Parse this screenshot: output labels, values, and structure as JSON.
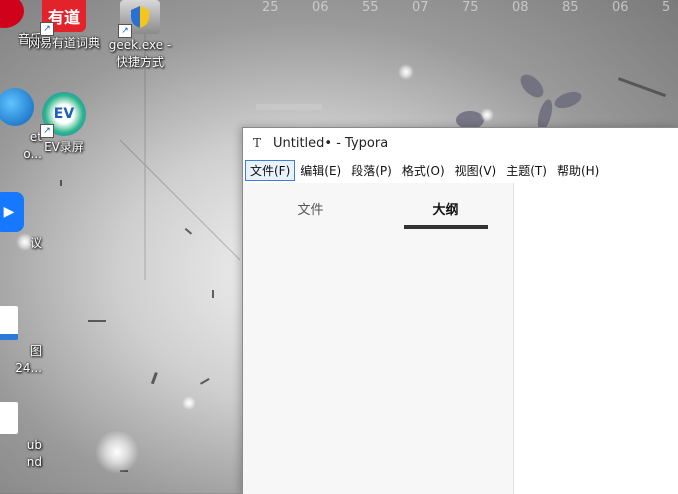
{
  "desktop": {
    "icons": [
      {
        "label": "音乐",
        "icon": "music-app-icon"
      },
      {
        "label": "网易有道词典",
        "icon": "youdao-dict-icon",
        "glyph": "有道"
      },
      {
        "label": "geek.exe - 快捷方式",
        "line1": "geek.exe -",
        "line2": "快捷方式",
        "icon": "geek-exe-icon"
      },
      {
        "label": "et",
        "line1": "et",
        "line2": "o...",
        "icon": "browser-icon"
      },
      {
        "label": "EV录屏",
        "icon": "ev-recorder-icon",
        "glyph": "EV"
      },
      {
        "label": "议",
        "icon": "meeting-app-icon"
      },
      {
        "label": "图",
        "line1": "图",
        "line2": "24...",
        "icon": "image-file-icon"
      },
      {
        "label": "ub",
        "line1": "ub",
        "line2": "nd",
        "icon": "document-file-icon"
      }
    ]
  },
  "window": {
    "title": "Untitled• - Typora",
    "app_icon": "T",
    "menu": [
      {
        "label": "文件(F)",
        "active": true
      },
      {
        "label": "编辑(E)"
      },
      {
        "label": "段落(P)"
      },
      {
        "label": "格式(O)"
      },
      {
        "label": "视图(V)"
      },
      {
        "label": "主题(T)"
      },
      {
        "label": "帮助(H)"
      }
    ],
    "sidebar": {
      "tabs": [
        {
          "label": "文件",
          "selected": false
        },
        {
          "label": "大纲",
          "selected": true
        }
      ]
    }
  },
  "colors": {
    "accent": "#3c7fd8",
    "tab_underline": "#333333",
    "sidebar_bg": "#f7f7f7"
  }
}
